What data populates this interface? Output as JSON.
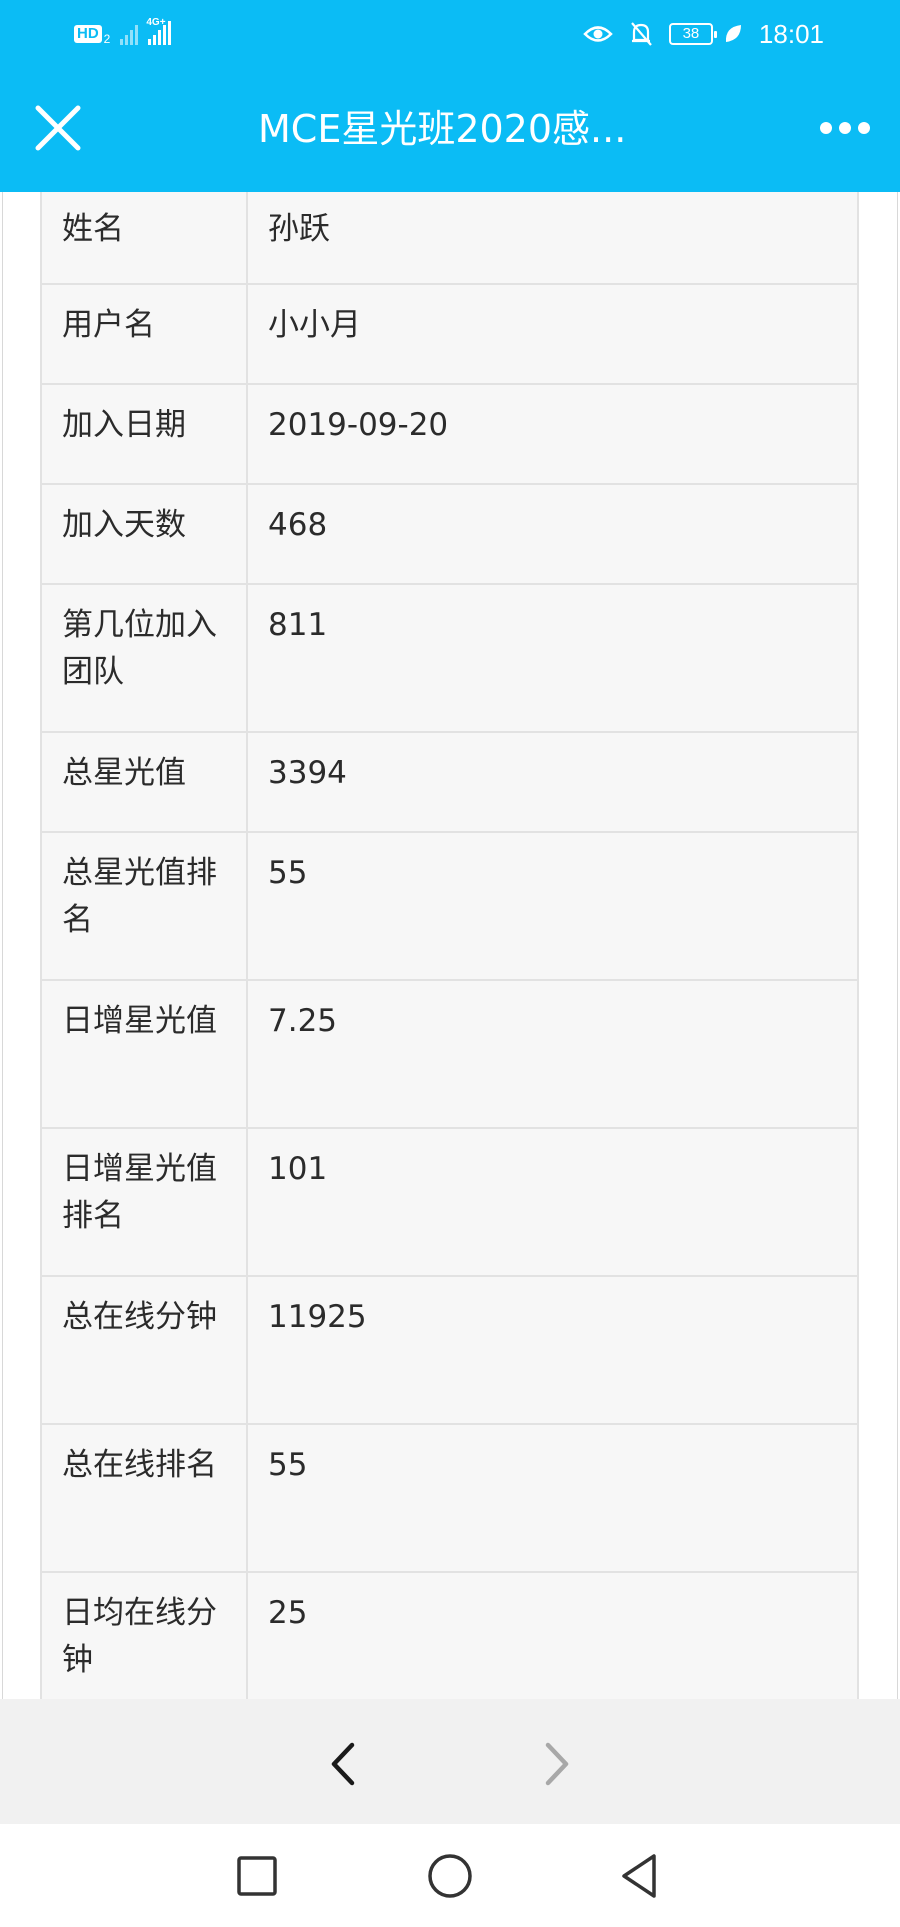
{
  "status_bar": {
    "hd_label": "HD",
    "hd_sub": "2",
    "network_tag": "4G+",
    "battery": "38",
    "time": "18:01",
    "icons": [
      "eye-icon",
      "bell-off-icon",
      "battery-icon",
      "leaf-icon"
    ]
  },
  "title_bar": {
    "title": "MCE星光班2020感..."
  },
  "profile_table": [
    {
      "label": "姓名",
      "value": "孙跃"
    },
    {
      "label": "用户名",
      "value": "小小月"
    },
    {
      "label": "加入日期",
      "value": "2019-09-20"
    },
    {
      "label": "加入天数",
      "value": "468"
    },
    {
      "label": "第几位加入团队",
      "value": "811"
    },
    {
      "label": "总星光值",
      "value": "3394"
    },
    {
      "label": "总星光值排名",
      "value": "55"
    },
    {
      "label": "日增星光值",
      "value": "7.25"
    },
    {
      "label": "日增星光值排名",
      "value": "101"
    },
    {
      "label": "总在线分钟",
      "value": "11925"
    },
    {
      "label": "总在线排名",
      "value": "55"
    },
    {
      "label": "日均在线分钟",
      "value": "25"
    }
  ],
  "colors": {
    "header": "#0bbcf5",
    "table_bg": "#f7f7f7",
    "table_border": "#e2e2e2",
    "nav_bg": "#f1f1f1",
    "text": "#2b2b2b"
  }
}
